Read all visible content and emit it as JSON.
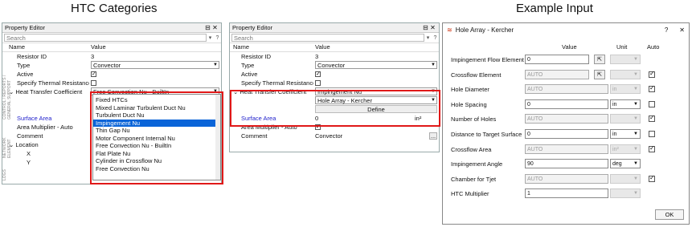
{
  "headings": {
    "htc": "HTC Categories",
    "example": "Example Input"
  },
  "left_panel": {
    "title": "Property Editor",
    "search_placeholder": "Search",
    "col_name": "Name",
    "col_value": "Value",
    "rows": [
      {
        "name": "Resistor ID",
        "value": "3"
      },
      {
        "name": "Type",
        "value": "Convector"
      },
      {
        "name": "Active",
        "value": ""
      },
      {
        "name": "Specify Thermal Resistance",
        "value": ""
      },
      {
        "name": "Heat Transfer Coefficient",
        "value": "Free Convection Nu - BuiltIn"
      },
      {
        "name": "Surface Area",
        "value": ""
      },
      {
        "name": "Area Multiplier - Auto",
        "value": ""
      },
      {
        "name": "Comment",
        "value": ""
      },
      {
        "name": "Location",
        "value": ""
      },
      {
        "name": "X",
        "value": ""
      },
      {
        "name": "Y",
        "value": ""
      }
    ],
    "dropdown_items": [
      "Fixed HTCs",
      "Mixed Laminar Turbulent Duct Nu",
      "Turbulent Duct Nu",
      "Impingement Nu",
      "Thin Gap Nu",
      "Motor Component Internal Nu",
      "Free Convection Nu - BuiltIn",
      "Flat Plate Nu",
      "Cylinder in Crossflow Nu",
      "Free Convection Nu"
    ],
    "selected_item": "Impingement Nu",
    "side_tabs": [
      "CONTROL / REPORTS / GENERAL SUPPORT",
      "NETWORK ELEMENT",
      "LOGS"
    ]
  },
  "mid_panel": {
    "title": "Property Editor",
    "search_placeholder": "Search",
    "col_name": "Name",
    "col_value": "Value",
    "rows": [
      {
        "name": "Resistor ID",
        "value": "3"
      },
      {
        "name": "Type",
        "value": "Convector"
      },
      {
        "name": "Active",
        "value": ""
      },
      {
        "name": "Specify Thermal Resistance",
        "value": ""
      },
      {
        "name": "Heat Transfer Coefficient",
        "value": "Impingement Nu"
      },
      {
        "name": "",
        "value": "Hole Array - Kercher"
      },
      {
        "name": "",
        "value": "Define"
      },
      {
        "name": "Surface Area",
        "value": "0"
      },
      {
        "name": "Area Multiplier - Auto",
        "value": ""
      },
      {
        "name": "Comment",
        "value": "Convector"
      }
    ],
    "surface_unit": "in²",
    "ellipsis": "..."
  },
  "dialog": {
    "title": "Hole Array - Kercher",
    "help": "?",
    "close": "✕",
    "col_value": "Value",
    "col_unit": "Unit",
    "col_auto": "Auto",
    "rows": [
      {
        "label": "Impingement Flow Element",
        "value": "0",
        "unit": "",
        "auto": null,
        "pick": true,
        "disabled": false
      },
      {
        "label": "Crossflow Element",
        "value": "AUTO",
        "unit": "",
        "auto": true,
        "pick": true,
        "disabled": true
      },
      {
        "label": "Hole Diameter",
        "value": "AUTO",
        "unit": "in",
        "auto": true,
        "pick": false,
        "disabled": true
      },
      {
        "label": "Hole Spacing",
        "value": "0",
        "unit": "in",
        "auto": false,
        "pick": false,
        "disabled": false
      },
      {
        "label": "Number of Holes",
        "value": "AUTO",
        "unit": "",
        "auto": true,
        "pick": false,
        "disabled": true
      },
      {
        "label": "Distance to Target Surface",
        "value": "0",
        "unit": "in",
        "auto": false,
        "pick": false,
        "disabled": false
      },
      {
        "label": "Crossflow Area",
        "value": "AUTO",
        "unit": "in²",
        "auto": true,
        "pick": false,
        "disabled": true
      },
      {
        "label": "Impingement Angle",
        "value": "90",
        "unit": "deg",
        "auto": null,
        "pick": false,
        "disabled": false
      },
      {
        "label": "Chamber for Tjet",
        "value": "AUTO",
        "unit": "",
        "auto": true,
        "pick": false,
        "disabled": true
      },
      {
        "label": "HTC Multiplier",
        "value": "1",
        "unit": "",
        "auto": null,
        "pick": false,
        "disabled": false
      }
    ],
    "ok": "OK"
  }
}
